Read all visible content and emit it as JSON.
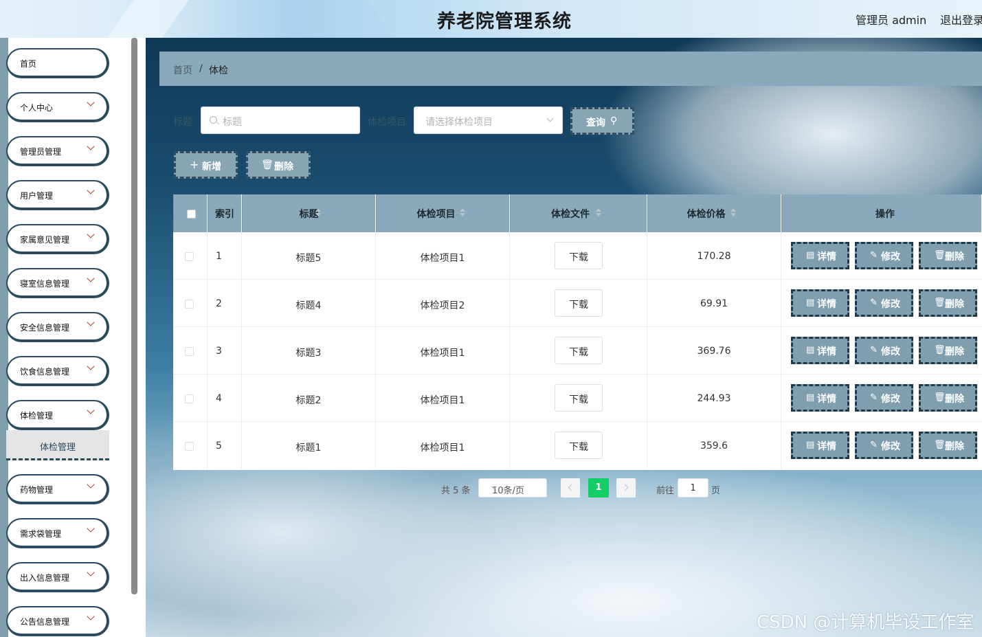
{
  "header": {
    "title": "养老院管理系统",
    "user": "管理员 admin",
    "logout": "退出登录"
  },
  "sidebar": {
    "items": [
      {
        "label": "首页",
        "has_chevron": false
      },
      {
        "label": "个人中心",
        "has_chevron": true
      },
      {
        "label": "管理员管理",
        "has_chevron": true
      },
      {
        "label": "用户管理",
        "has_chevron": true
      },
      {
        "label": "家属意见管理",
        "has_chevron": true
      },
      {
        "label": "寝室信息管理",
        "has_chevron": true
      },
      {
        "label": "安全信息管理",
        "has_chevron": true
      },
      {
        "label": "饮食信息管理",
        "has_chevron": true
      },
      {
        "label": "体检管理",
        "has_chevron": true
      },
      {
        "label": "药物管理",
        "has_chevron": true
      },
      {
        "label": "需求袋管理",
        "has_chevron": true
      },
      {
        "label": "出入信息管理",
        "has_chevron": true
      },
      {
        "label": "公告信息管理",
        "has_chevron": true
      }
    ],
    "active_submenu": "体检管理"
  },
  "breadcrumb": {
    "home": "首页",
    "separator": "/",
    "current": "体检"
  },
  "filters": {
    "title_label": "标题",
    "title_placeholder": "标题",
    "item_label": "体检项目",
    "item_placeholder": "请选择体检项目",
    "query_button": "查询"
  },
  "actions": {
    "add": "新增",
    "delete": "删除"
  },
  "table": {
    "columns": [
      "索引",
      "标题",
      "体检项目",
      "体检文件",
      "体检价格",
      "操作"
    ],
    "download_label": "下载",
    "op_labels": {
      "detail": "详情",
      "edit": "修改",
      "delete": "删除"
    },
    "rows": [
      {
        "index": "1",
        "title": "标题5",
        "item": "体检项目1",
        "price": "170.28"
      },
      {
        "index": "2",
        "title": "标题4",
        "item": "体检项目2",
        "price": "69.91"
      },
      {
        "index": "3",
        "title": "标题3",
        "item": "体检项目1",
        "price": "369.76"
      },
      {
        "index": "4",
        "title": "标题2",
        "item": "体检项目1",
        "price": "244.93"
      },
      {
        "index": "5",
        "title": "标题1",
        "item": "体检项目1",
        "price": "359.6"
      }
    ]
  },
  "pagination": {
    "total": "共 5 条",
    "page_size": "10条/页",
    "current_page": "1",
    "goto_label": "前往",
    "goto_value": "1",
    "page_suffix": "页"
  },
  "watermark": "CSDN @计算机毕设工作室",
  "colors": {
    "accent": "#88a5b5",
    "dark_border": "#2a4a5e",
    "page_active": "#13ce66"
  }
}
